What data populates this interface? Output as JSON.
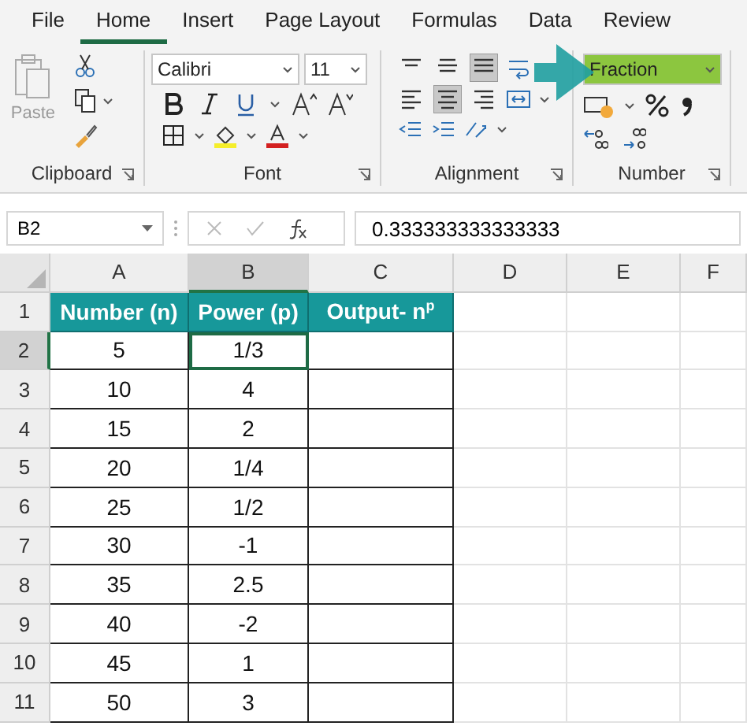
{
  "tabs": [
    {
      "label": "File",
      "selected": false
    },
    {
      "label": "Home",
      "selected": true
    },
    {
      "label": "Insert",
      "selected": false
    },
    {
      "label": "Page Layout",
      "selected": false
    },
    {
      "label": "Formulas",
      "selected": false
    },
    {
      "label": "Data",
      "selected": false
    },
    {
      "label": "Review",
      "selected": false
    }
  ],
  "ribbon": {
    "clipboard": {
      "paste_label": "Paste",
      "title": "Clipboard"
    },
    "font": {
      "font_name": "Calibri",
      "font_size": "11",
      "title": "Font"
    },
    "alignment": {
      "title": "Alignment"
    },
    "number": {
      "format": "Fraction",
      "title": "Number"
    }
  },
  "formula_bar": {
    "name_box": "B2",
    "value": "0.333333333333333"
  },
  "sheet": {
    "columns": [
      {
        "label": "A",
        "selected": false
      },
      {
        "label": "B",
        "selected": true
      },
      {
        "label": "C",
        "selected": false
      },
      {
        "label": "D",
        "selected": false
      },
      {
        "label": "E",
        "selected": false
      },
      {
        "label": "F",
        "selected": false
      }
    ],
    "rows": [
      {
        "number": "1",
        "selected": false,
        "cells": [
          {
            "kind": "header",
            "text": "Number (n)",
            "selected": false
          },
          {
            "kind": "header",
            "text": "Power (p)",
            "selected": false
          },
          {
            "kind": "header",
            "text": "Output- n$^{p}$",
            "selected": false
          }
        ]
      },
      {
        "number": "2",
        "selected": true,
        "cells": [
          {
            "kind": "data",
            "text": "5",
            "selected": false
          },
          {
            "kind": "data",
            "text": "1/3",
            "selected": true
          },
          {
            "kind": "data",
            "text": "",
            "selected": false
          }
        ]
      },
      {
        "number": "3",
        "selected": false,
        "cells": [
          {
            "kind": "data",
            "text": "10",
            "selected": false
          },
          {
            "kind": "data",
            "text": "4",
            "selected": false
          },
          {
            "kind": "data",
            "text": "",
            "selected": false
          }
        ]
      },
      {
        "number": "4",
        "selected": false,
        "cells": [
          {
            "kind": "data",
            "text": "15",
            "selected": false
          },
          {
            "kind": "data",
            "text": "2",
            "selected": false
          },
          {
            "kind": "data",
            "text": "",
            "selected": false
          }
        ]
      },
      {
        "number": "5",
        "selected": false,
        "cells": [
          {
            "kind": "data",
            "text": "20",
            "selected": false
          },
          {
            "kind": "data",
            "text": "1/4",
            "selected": false
          },
          {
            "kind": "data",
            "text": "",
            "selected": false
          }
        ]
      },
      {
        "number": "6",
        "selected": false,
        "cells": [
          {
            "kind": "data",
            "text": "25",
            "selected": false
          },
          {
            "kind": "data",
            "text": "1/2",
            "selected": false
          },
          {
            "kind": "data",
            "text": "",
            "selected": false
          }
        ]
      },
      {
        "number": "7",
        "selected": false,
        "cells": [
          {
            "kind": "data",
            "text": "30",
            "selected": false
          },
          {
            "kind": "data",
            "text": "-1",
            "selected": false
          },
          {
            "kind": "data",
            "text": "",
            "selected": false
          }
        ]
      },
      {
        "number": "8",
        "selected": false,
        "cells": [
          {
            "kind": "data",
            "text": "35",
            "selected": false
          },
          {
            "kind": "data",
            "text": "2.5",
            "selected": false
          },
          {
            "kind": "data",
            "text": "",
            "selected": false
          }
        ]
      },
      {
        "number": "9",
        "selected": false,
        "cells": [
          {
            "kind": "data",
            "text": "40",
            "selected": false
          },
          {
            "kind": "data",
            "text": "-2",
            "selected": false
          },
          {
            "kind": "data",
            "text": "",
            "selected": false
          }
        ]
      },
      {
        "number": "10",
        "selected": false,
        "cells": [
          {
            "kind": "data",
            "text": "45",
            "selected": false
          },
          {
            "kind": "data",
            "text": "1",
            "selected": false
          },
          {
            "kind": "data",
            "text": "",
            "selected": false
          }
        ]
      },
      {
        "number": "11",
        "selected": false,
        "cells": [
          {
            "kind": "data",
            "text": "50",
            "selected": false
          },
          {
            "kind": "data",
            "text": "3",
            "selected": false
          },
          {
            "kind": "data",
            "text": "",
            "selected": false
          }
        ]
      }
    ]
  }
}
